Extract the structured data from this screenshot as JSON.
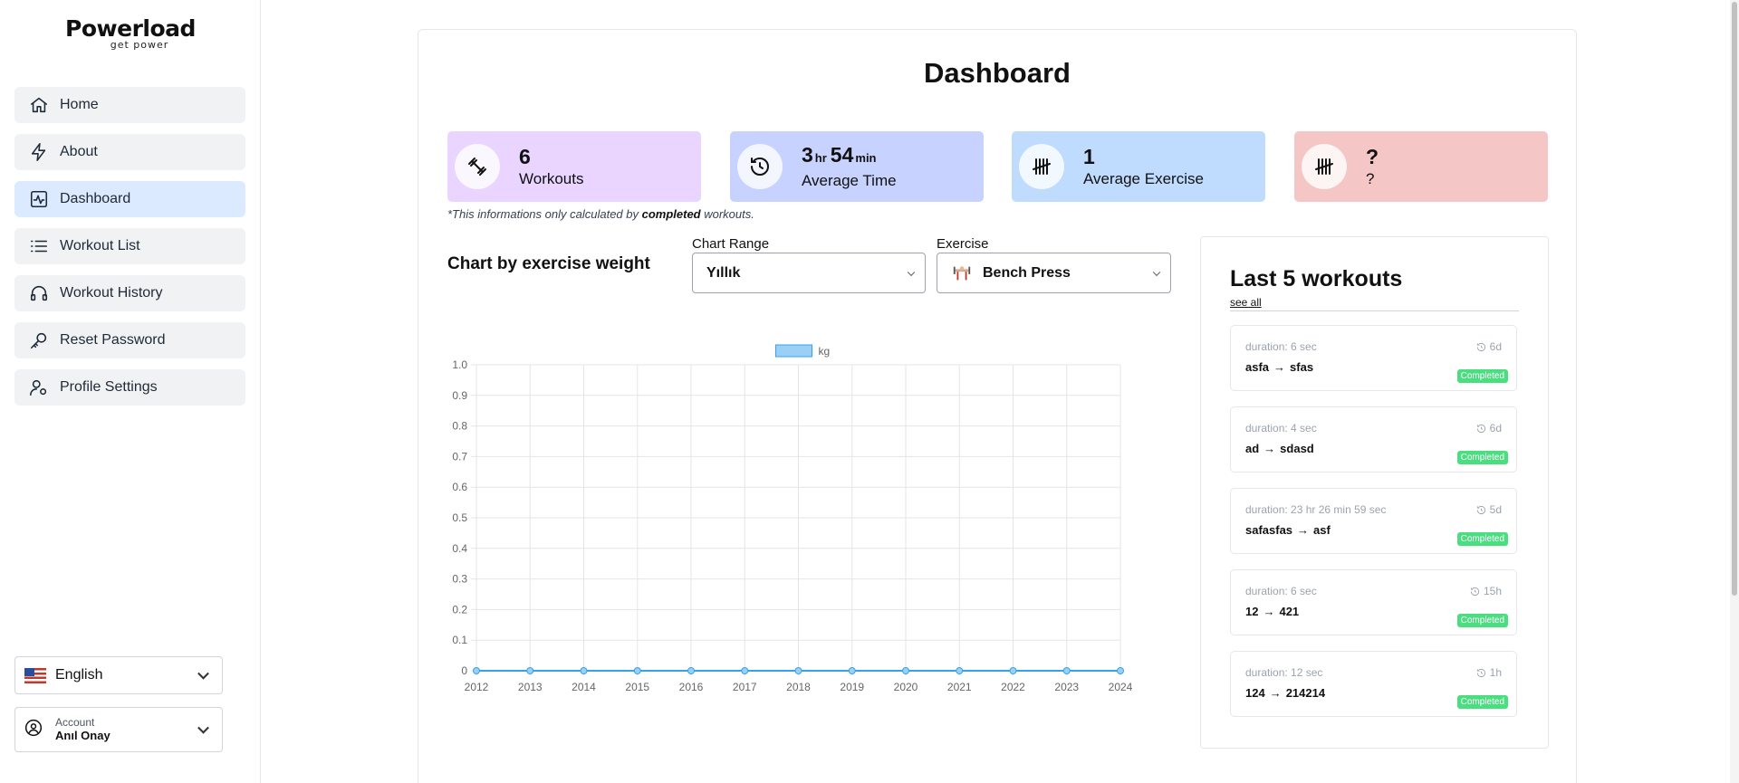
{
  "brand": {
    "name": "Powerload",
    "tagline": "get power"
  },
  "sidebar": {
    "items": [
      {
        "label": "Home",
        "icon": "home-icon"
      },
      {
        "label": "About",
        "icon": "bolt-icon"
      },
      {
        "label": "Dashboard",
        "icon": "activity-icon",
        "active": true
      },
      {
        "label": "Workout List",
        "icon": "list-icon"
      },
      {
        "label": "Workout History",
        "icon": "headphones-icon"
      },
      {
        "label": "Reset Password",
        "icon": "key-icon"
      },
      {
        "label": "Profile Settings",
        "icon": "user-settings-icon"
      }
    ],
    "language": "English",
    "account": {
      "label": "Account",
      "name": "Anıl Onay"
    }
  },
  "page": {
    "title": "Dashboard"
  },
  "stats": [
    {
      "value": "6",
      "caption": "Workouts",
      "color": "#e9d5ff"
    },
    {
      "hours": "3",
      "hours_unit": "hr",
      "minutes": "54",
      "minutes_unit": "min",
      "caption": "Average Time",
      "color": "#c7d2fe"
    },
    {
      "value": "1",
      "caption": "Average Exercise",
      "color": "#bfdbfe"
    },
    {
      "value": "?",
      "caption": "?",
      "color": "#f5c6c6"
    }
  ],
  "note": {
    "prefix": "*This informations only calculated by ",
    "bold": "completed",
    "suffix": " workouts."
  },
  "chart_controls": {
    "title": "Chart by exercise weight",
    "range_label": "Chart Range",
    "range_value": "Yıllık",
    "exercise_label": "Exercise",
    "exercise_value": "Bench Press"
  },
  "chart_data": {
    "type": "line",
    "x": [
      "2012",
      "2013",
      "2014",
      "2015",
      "2016",
      "2017",
      "2018",
      "2019",
      "2020",
      "2021",
      "2022",
      "2023",
      "2024"
    ],
    "series": [
      {
        "name": "kg",
        "values": [
          0,
          0,
          0,
          0,
          0,
          0,
          0,
          0,
          0,
          0,
          0,
          0,
          0
        ],
        "color": "#36a2eb"
      }
    ],
    "ylim": [
      0,
      1.0
    ],
    "yticks": [
      "0",
      "0.1",
      "0.2",
      "0.3",
      "0.4",
      "0.5",
      "0.6",
      "0.7",
      "0.8",
      "0.9",
      "1.0"
    ],
    "grid": true,
    "legend": "top-center"
  },
  "last_workouts": {
    "title": "Last 5 workouts",
    "see_all": "see all",
    "items": [
      {
        "duration": "duration: 6 sec",
        "ago": "6d",
        "from": "asfa",
        "to": "sfas",
        "status": "Completed"
      },
      {
        "duration": "duration: 4 sec",
        "ago": "6d",
        "from": "ad",
        "to": "sdasd",
        "status": "Completed"
      },
      {
        "duration": "duration: 23 hr  26 min  59 sec",
        "ago": "5d",
        "from": "safasfas",
        "to": "asf",
        "status": "Completed"
      },
      {
        "duration": "duration: 6 sec",
        "ago": "15h",
        "from": "12",
        "to": "421",
        "status": "Completed"
      },
      {
        "duration": "duration: 12 sec",
        "ago": "1h",
        "from": "124",
        "to": "214214",
        "status": "Completed"
      }
    ],
    "arrow": "→"
  }
}
